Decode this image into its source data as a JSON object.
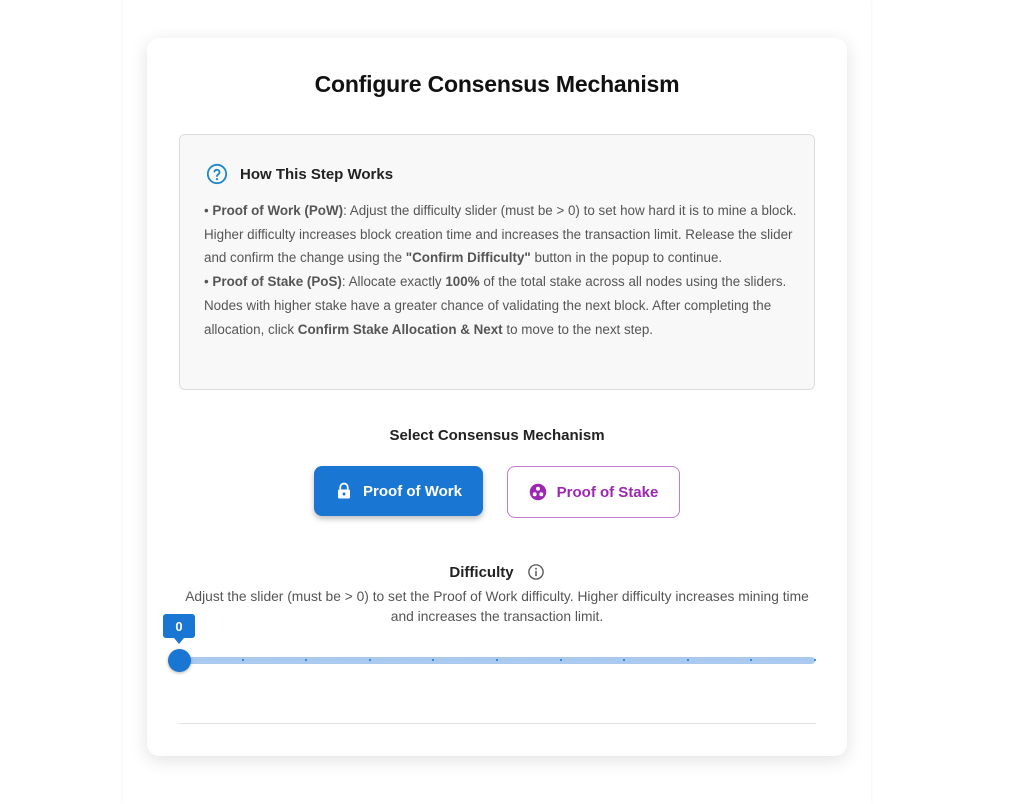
{
  "title": "Configure Consensus Mechanism",
  "info": {
    "title": "How This Step Works",
    "pow": {
      "bullet": "• ",
      "name": "Proof of Work (PoW)",
      "text1": ": Adjust the difficulty slider (must be > 0) to set how hard it is to mine a block. Higher difficulty increases block creation time and increases the transaction limit. Release the slider and confirm the change using the ",
      "confirm_label": "\"Confirm Difficulty\"",
      "text2": " button in the popup to continue."
    },
    "pos": {
      "bullet": "• ",
      "name": "Proof of Stake (PoS)",
      "text1": ": Allocate exactly ",
      "percent": "100%",
      "text2": " of the total stake across all nodes using the sliders. Nodes with higher stake have a greater chance of validating the next block. After completing the allocation, click ",
      "confirm_label": "Confirm Stake Allocation & Next",
      "text3": " to move to the next step."
    }
  },
  "select_label": "Select Consensus Mechanism",
  "buttons": {
    "pow_label": "Proof of Work",
    "pos_label": "Proof of Stake"
  },
  "difficulty": {
    "label": "Difficulty",
    "description": "Adjust the slider (must be > 0) to set the Proof of Work difficulty. Higher difficulty increases mining time and increases the transaction limit.",
    "value": "0",
    "level_fraction": 0
  },
  "colors": {
    "primary": "#1976d2",
    "secondary": "#9c27b0",
    "rail": "#a9c9ef"
  },
  "icons": {
    "help": "help-circle-icon",
    "pow": "lock-icon",
    "pos": "workspaces-icon",
    "info": "info-icon"
  }
}
